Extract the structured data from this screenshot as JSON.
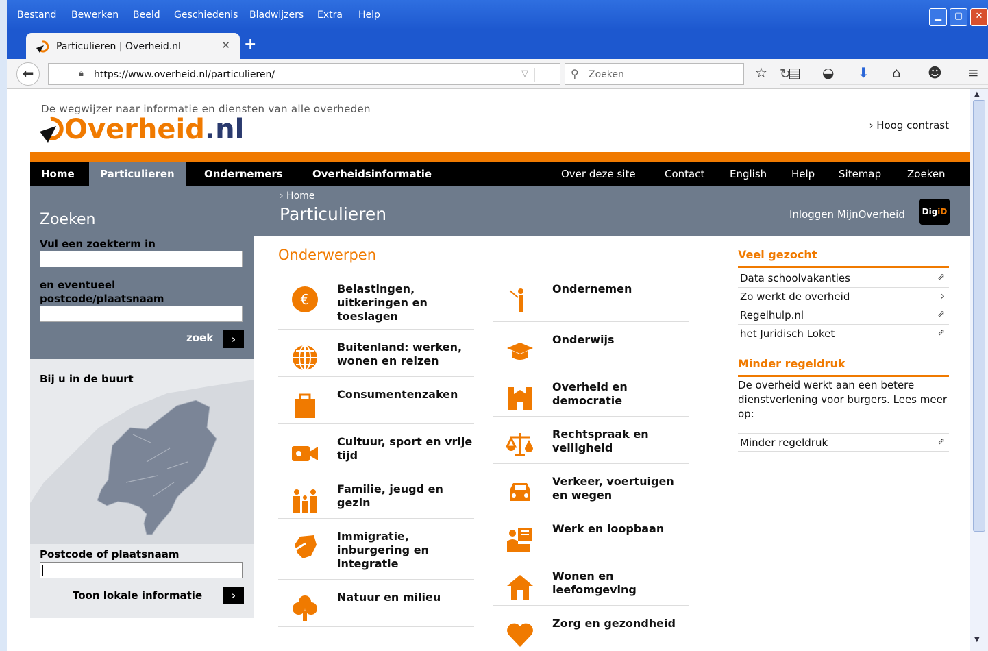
{
  "browser": {
    "menu": [
      "Bestand",
      "Bewerken",
      "Beeld",
      "Geschiedenis",
      "Bladwijzers",
      "Extra",
      "Help"
    ],
    "tab_title": "Particulieren | Overheid.nl",
    "url": "https://www.overheid.nl/particulieren/",
    "search_placeholder": "Zoeken"
  },
  "header": {
    "tagline": "De wegwijzer naar informatie en diensten van alle overheden",
    "logo_main": "Overheid",
    "logo_tld": ".nl",
    "hoog_contrast": "› Hoog contrast"
  },
  "nav": {
    "left": [
      "Home",
      "Particulieren",
      "Ondernemers",
      "Overheidsinformatie"
    ],
    "right": [
      "Over deze site",
      "Contact",
      "English",
      "Help",
      "Sitemap",
      "Zoeken"
    ],
    "active": "Particulieren"
  },
  "band": {
    "breadcrumb": "› Home",
    "page_title": "Particulieren",
    "login": "Inloggen MijnOverheid",
    "digid_a": "Dig",
    "digid_b": "iD",
    "search_title": "Zoeken"
  },
  "search": {
    "term_label": "Vul een zoekterm in",
    "postcode_label_1": "en eventueel",
    "postcode_label_2": "postcode/plaatsnaam",
    "zoek": "zoek"
  },
  "buurt": {
    "title": "Bij u in de buurt",
    "postcode_label": "Postcode of plaatsnaam",
    "toon": "Toon lokale informatie"
  },
  "onderwerpen": {
    "title": "Onderwerpen",
    "left": [
      {
        "label": "Belastingen, uitkeringen en toeslagen",
        "icon": "euro-icon"
      },
      {
        "label": "Buitenland: werken, wonen en reizen",
        "icon": "globe-icon"
      },
      {
        "label": "Consumentenzaken",
        "icon": "shopping-bag-icon"
      },
      {
        "label": "Cultuur, sport en vrije tijd",
        "icon": "video-camera-icon"
      },
      {
        "label": "Familie, jeugd en gezin",
        "icon": "family-icon"
      },
      {
        "label": "Immigratie, inburgering en integratie",
        "icon": "map-arrow-icon"
      },
      {
        "label": "Natuur en milieu",
        "icon": "tree-icon"
      }
    ],
    "right": [
      {
        "label": "Ondernemen",
        "icon": "person-flag-icon"
      },
      {
        "label": "Onderwijs",
        "icon": "graduation-cap-icon"
      },
      {
        "label": "Overheid en democratie",
        "icon": "government-building-icon"
      },
      {
        "label": "Rechtspraak en veiligheid",
        "icon": "scales-icon"
      },
      {
        "label": "Verkeer, voertuigen en wegen",
        "icon": "car-icon"
      },
      {
        "label": "Werk en loopbaan",
        "icon": "worker-desk-icon"
      },
      {
        "label": "Wonen en leefomgeving",
        "icon": "house-icon"
      },
      {
        "label": "Zorg en gezondheid",
        "icon": "heart-icon"
      }
    ]
  },
  "veel_gezocht": {
    "title": "Veel gezocht",
    "links": [
      {
        "label": "Data schoolvakanties",
        "marker": "⇗"
      },
      {
        "label": "Zo werkt de overheid",
        "marker": "›"
      },
      {
        "label": "Regelhulp.nl",
        "marker": "⇗"
      },
      {
        "label": "het Juridisch Loket",
        "marker": "⇗"
      }
    ]
  },
  "minder_regeldruk": {
    "title": "Minder regeldruk",
    "text": "De overheid werkt aan een betere dienstverlening voor burgers. Lees meer op:",
    "link": "Minder regeldruk",
    "marker": "⇗"
  },
  "colors": {
    "accent": "#f07a00",
    "band": "#6e7b8c",
    "nav": "#000000"
  }
}
